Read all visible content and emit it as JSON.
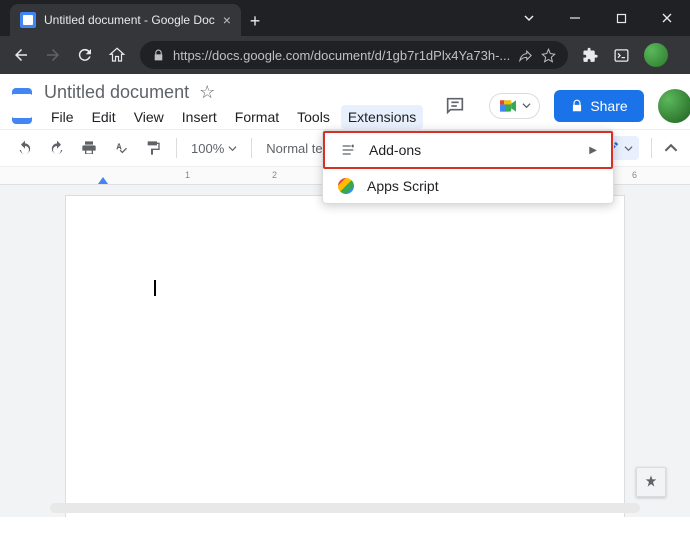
{
  "browser": {
    "tab_title": "Untitled document - Google Doc",
    "url": "https://docs.google.com/document/d/1gb7r1dPlx4Ya73h-..."
  },
  "docs": {
    "title": "Untitled document",
    "menubar": [
      "File",
      "Edit",
      "View",
      "Insert",
      "Format",
      "Tools",
      "Extensions"
    ],
    "active_menu": "Extensions",
    "share_label": "Share"
  },
  "toolbar": {
    "zoom": "100%",
    "paragraph_style": "Normal text"
  },
  "dropdown": {
    "items": [
      {
        "label": "Add-ons",
        "has_submenu": true,
        "highlighted": true,
        "icon": "addons"
      },
      {
        "label": "Apps Script",
        "has_submenu": false,
        "highlighted": false,
        "icon": "apps-script"
      }
    ]
  },
  "ruler": {
    "numbers": [
      "1",
      "2",
      "6"
    ]
  }
}
